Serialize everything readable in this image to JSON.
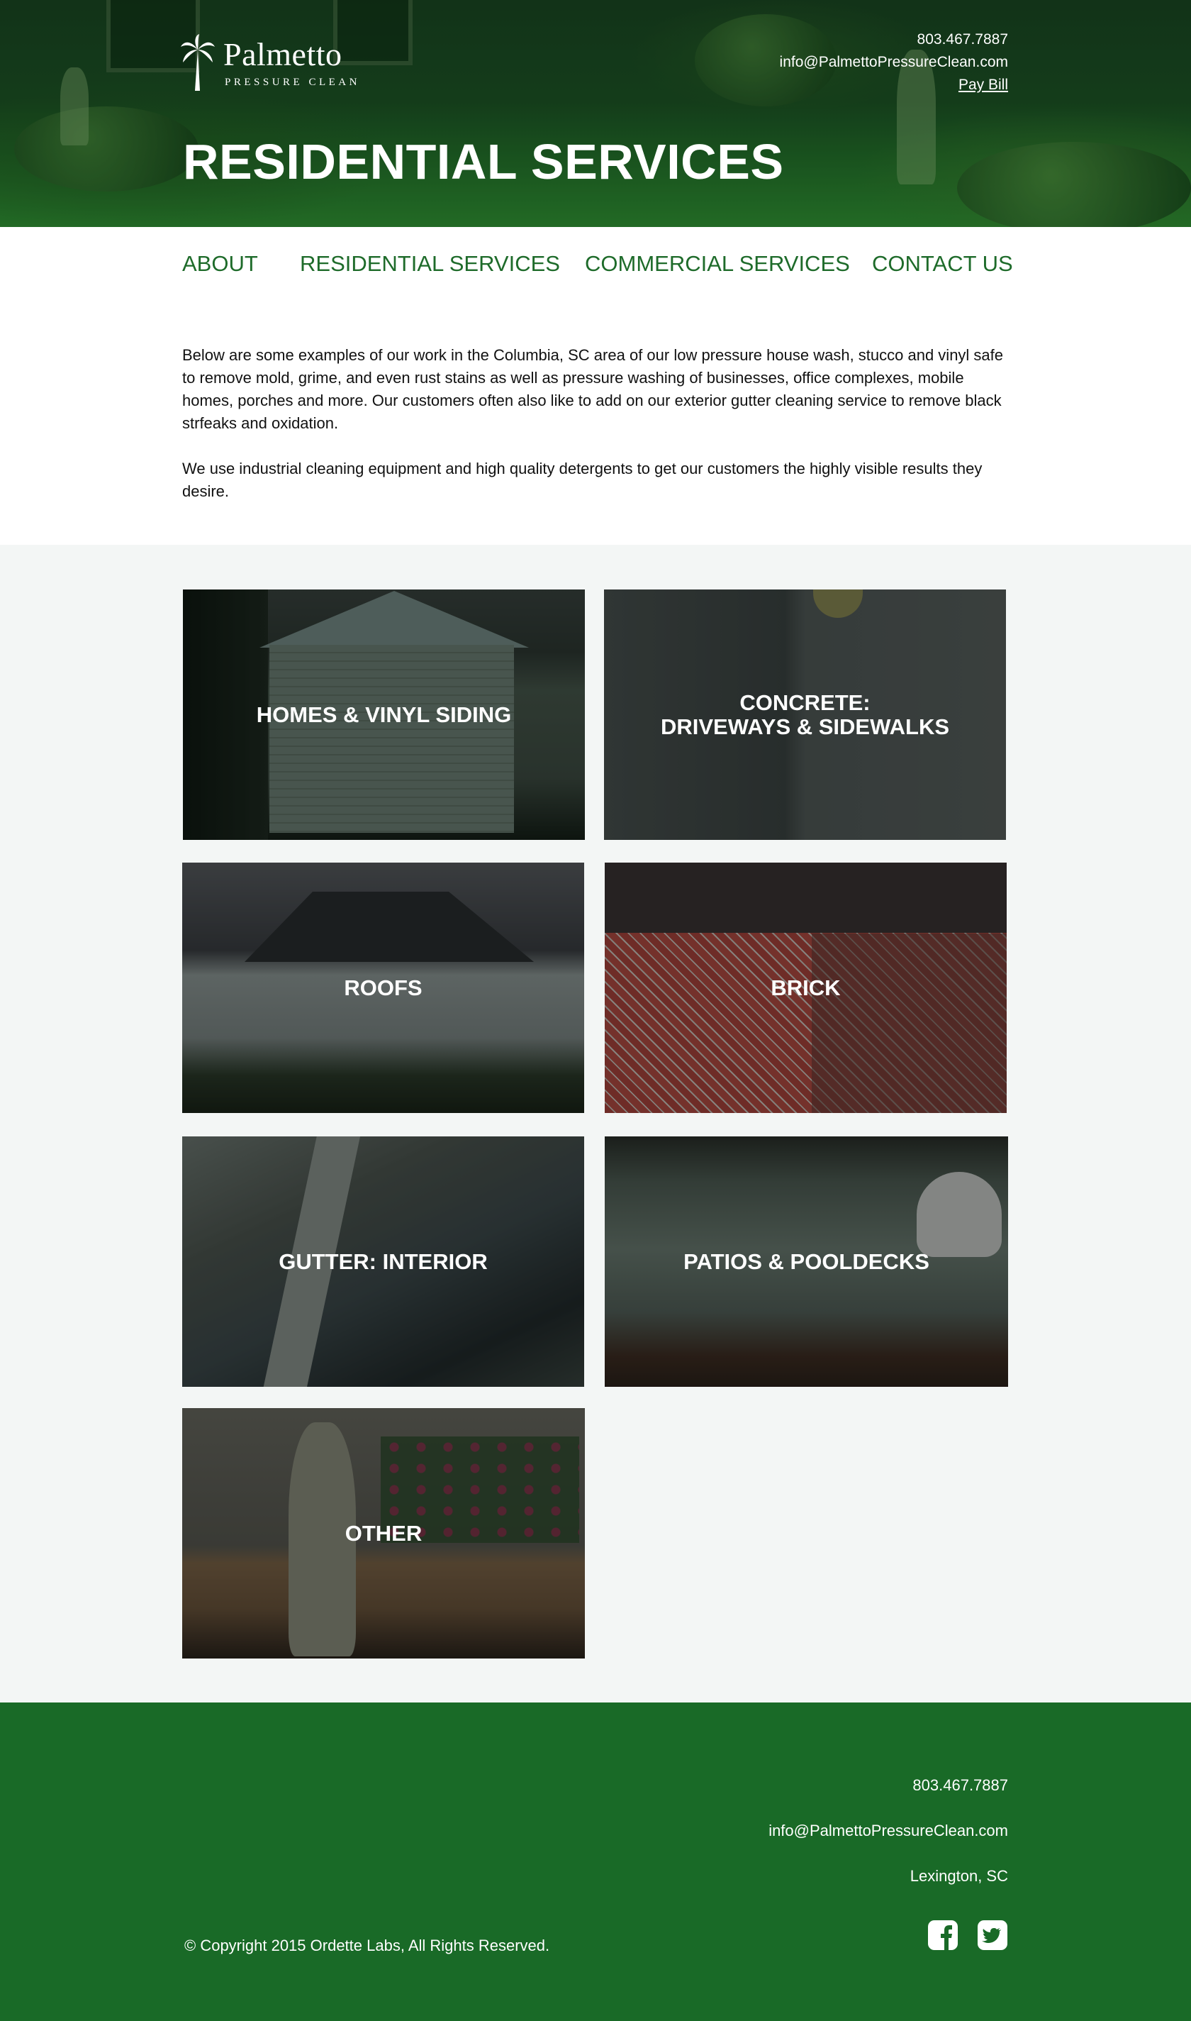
{
  "header": {
    "logo_name": "Palmetto",
    "logo_sub": "PRESSURE CLEAN",
    "phone": "803.467.7887",
    "email": "info@PalmettoPressureClean.com",
    "pay_bill": "Pay Bill",
    "title": "RESIDENTIAL SERVICES"
  },
  "nav": {
    "items": [
      {
        "label": "ABOUT"
      },
      {
        "label": "RESIDENTIAL SERVICES"
      },
      {
        "label": "COMMERCIAL SERVICES"
      },
      {
        "label": "CONTACT US"
      }
    ],
    "color": "#1e6b2a"
  },
  "intro": {
    "p1": "Below are some examples of our work in the Columbia, SC area of our low pressure house wash, stucco and vinyl safe to remove mold, grime, and even rust stains as well as pressure washing of businesses, office complexes, mobile homes, porches and more.  Our customers often also like to add on our exterior gutter cleaning service to remove black strfeaks and oxidation.",
    "p2": "We use industrial cleaning equipment and high quality detergents to get our customers the highly visible results they desire."
  },
  "services": [
    {
      "line1": "HOMES & VINYL SIDING",
      "line2": ""
    },
    {
      "line1": "CONCRETE:",
      "line2": "DRIVEWAYS & SIDEWALKS"
    },
    {
      "line1": "ROOFS",
      "line2": ""
    },
    {
      "line1": "BRICK",
      "line2": ""
    },
    {
      "line1": "GUTTER: INTERIOR",
      "line2": ""
    },
    {
      "line1": "PATIOS & POOLDECKS",
      "line2": ""
    },
    {
      "line1": "OTHER",
      "line2": ""
    }
  ],
  "footer": {
    "phone": "803.467.7887",
    "email": "info@PalmettoPressureClean.com",
    "location": "Lexington, SC",
    "copyright": "© Copyright 2015 Ordette Labs, All Rights Reserved.",
    "social": [
      "facebook-icon",
      "twitter-icon"
    ],
    "bg_color": "#196a27"
  }
}
